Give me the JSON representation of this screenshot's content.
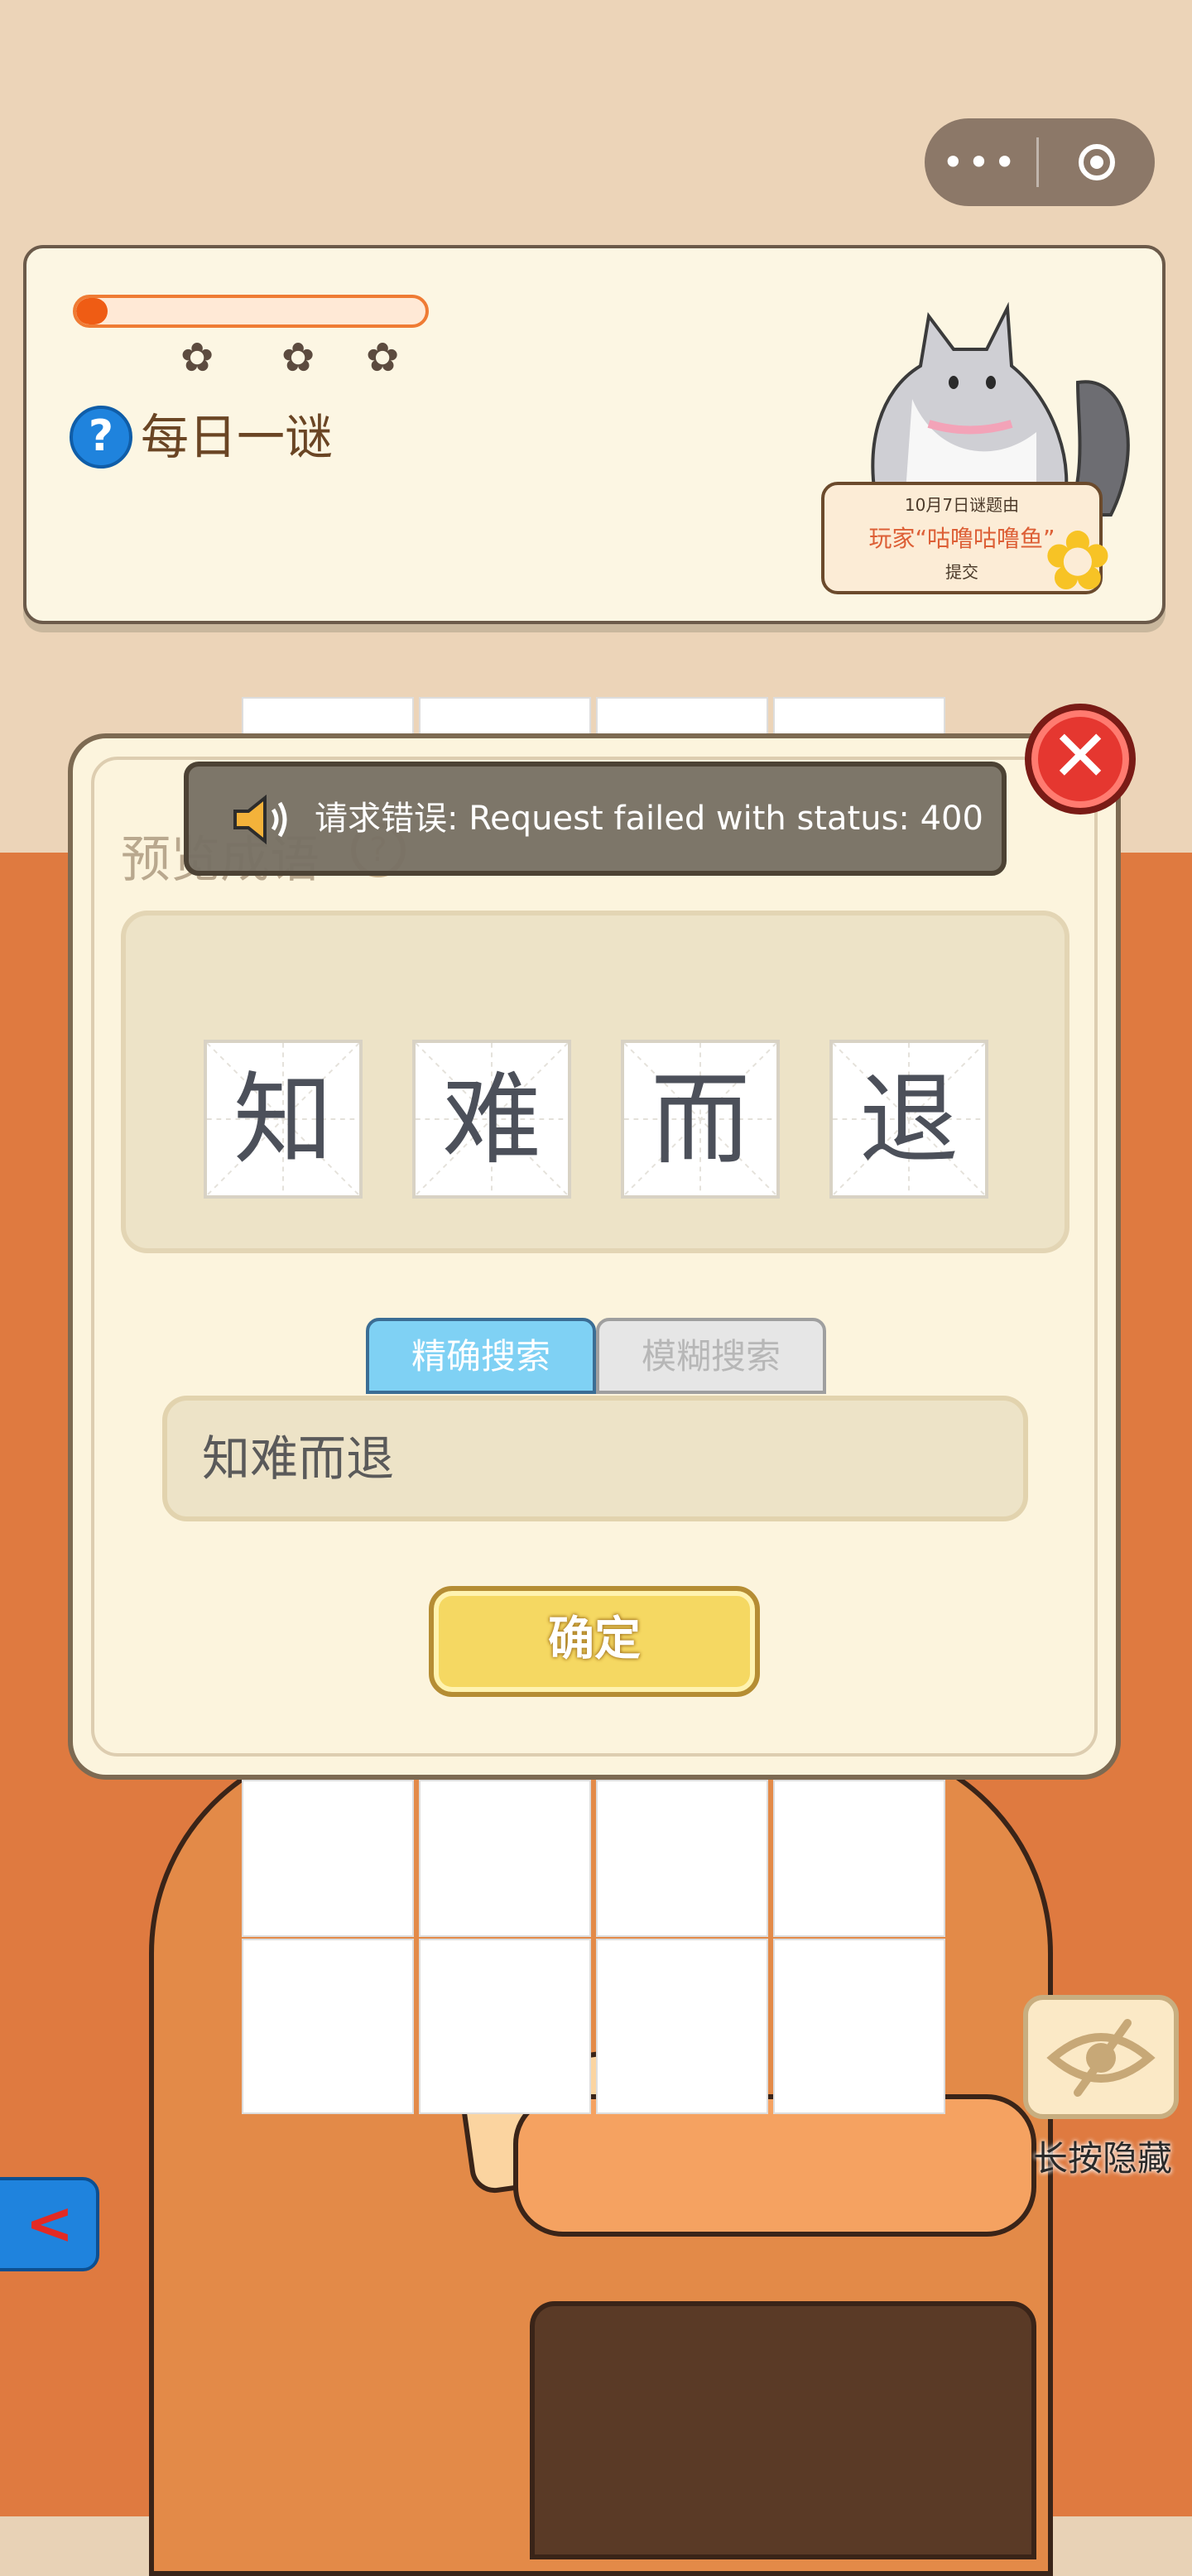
{
  "capsule": {
    "more_icon": "more-dots-icon",
    "close_icon": "target-circle-icon"
  },
  "header": {
    "progress_fraction": 0.04,
    "title": "每日一谜",
    "help_icon": "?",
    "credit": {
      "line1": "10月7日谜题由",
      "line2": "玩家“咕噜咕噜鱼”",
      "line3": "提交"
    }
  },
  "modal": {
    "title": "预览成语",
    "title_help": "?",
    "idiom_chars": [
      "知",
      "难",
      "而",
      "退"
    ],
    "tabs": {
      "precise": "精确搜索",
      "fuzzy": "模糊搜索"
    },
    "search_value": "知难而退",
    "confirm_label": "确定",
    "close_icon": "✕"
  },
  "toast": {
    "message": "请求错误: Request failed with status: 400"
  },
  "side": {
    "hide_label": "长按隐藏",
    "back_icon": "<"
  },
  "colors": {
    "accent_orange": "#df7a40",
    "tab_active": "#7fd1f4",
    "confirm_yellow": "#f5d862",
    "close_red": "#e53730"
  }
}
